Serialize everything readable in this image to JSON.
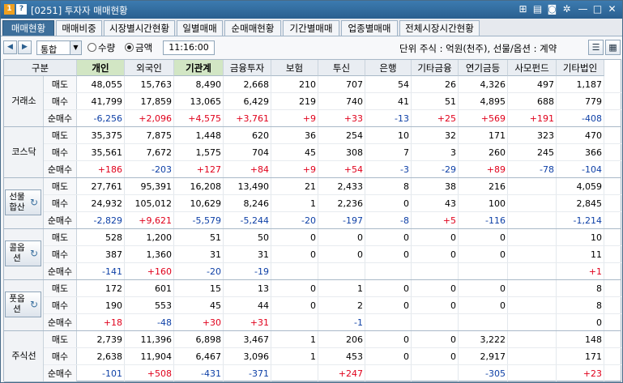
{
  "window": {
    "number": "1",
    "help": "?",
    "title": "[0251] 투자자 매매현황"
  },
  "tabs": [
    "매매현황",
    "매매비중",
    "시장별시간현황",
    "일별매매",
    "순매매현황",
    "기간별매매",
    "업종별매매",
    "전체시장시간현황"
  ],
  "active_tab": 0,
  "toolbar": {
    "market": "통합",
    "radio_qty": "수량",
    "radio_amount": "금액",
    "selected": "금액",
    "time": "11:16:00",
    "unit": "단위 주식 : 억원(천주), 선물/옵션 : 계약"
  },
  "table": {
    "corner": "구분",
    "columns": [
      "개인",
      "외국인",
      "기관계",
      "금융투자",
      "보험",
      "투신",
      "은행",
      "기타금융",
      "연기금등",
      "사모펀드",
      "기타법인"
    ],
    "bold_columns": [
      0,
      2
    ],
    "row_labels": [
      "매도",
      "매수",
      "순매수"
    ],
    "groups": [
      {
        "name": "거래소",
        "button": false,
        "rows": [
          [
            "48,055",
            "15,763",
            "8,490",
            "2,668",
            "210",
            "707",
            "54",
            "26",
            "4,326",
            "497",
            "1,187"
          ],
          [
            "41,799",
            "17,859",
            "13,065",
            "6,429",
            "219",
            "740",
            "41",
            "51",
            "4,895",
            "688",
            "779"
          ],
          [
            "-6,256",
            "+2,096",
            "+4,575",
            "+3,761",
            "+9",
            "+33",
            "-13",
            "+25",
            "+569",
            "+191",
            "-408"
          ]
        ]
      },
      {
        "name": "코스닥",
        "button": false,
        "rows": [
          [
            "35,375",
            "7,875",
            "1,448",
            "620",
            "36",
            "254",
            "10",
            "32",
            "171",
            "323",
            "470"
          ],
          [
            "35,561",
            "7,672",
            "1,575",
            "704",
            "45",
            "308",
            "7",
            "3",
            "260",
            "245",
            "366"
          ],
          [
            "+186",
            "-203",
            "+127",
            "+84",
            "+9",
            "+54",
            "-3",
            "-29",
            "+89",
            "-78",
            "-104"
          ]
        ]
      },
      {
        "name": "선물합산",
        "button": true,
        "rows": [
          [
            "27,761",
            "95,391",
            "16,208",
            "13,490",
            "21",
            "2,433",
            "8",
            "38",
            "216",
            "",
            "4,059"
          ],
          [
            "24,932",
            "105,012",
            "10,629",
            "8,246",
            "1",
            "2,236",
            "0",
            "43",
            "100",
            "",
            "2,845"
          ],
          [
            "-2,829",
            "+9,621",
            "-5,579",
            "-5,244",
            "-20",
            "-197",
            "-8",
            "+5",
            "-116",
            "",
            "-1,214"
          ]
        ]
      },
      {
        "name": "콜옵션",
        "button": true,
        "rows": [
          [
            "528",
            "1,200",
            "51",
            "50",
            "0",
            "0",
            "0",
            "0",
            "0",
            "",
            "10"
          ],
          [
            "387",
            "1,360",
            "31",
            "31",
            "0",
            "0",
            "0",
            "0",
            "0",
            "",
            "11"
          ],
          [
            "-141",
            "+160",
            "-20",
            "-19",
            "",
            "",
            "",
            "",
            "",
            "",
            "+1"
          ]
        ]
      },
      {
        "name": "풋옵션",
        "button": true,
        "rows": [
          [
            "172",
            "601",
            "15",
            "13",
            "0",
            "1",
            "0",
            "0",
            "0",
            "",
            "8"
          ],
          [
            "190",
            "553",
            "45",
            "44",
            "0",
            "2",
            "0",
            "0",
            "0",
            "",
            "8"
          ],
          [
            "+18",
            "-48",
            "+30",
            "+31",
            "",
            "-1",
            "",
            "",
            "",
            "",
            "0"
          ]
        ]
      },
      {
        "name": "주식선",
        "button": false,
        "rows": [
          [
            "2,739",
            "11,396",
            "6,898",
            "3,467",
            "1",
            "206",
            "0",
            "0",
            "3,222",
            "",
            "148"
          ],
          [
            "2,638",
            "11,904",
            "6,467",
            "3,096",
            "1",
            "453",
            "0",
            "0",
            "2,917",
            "",
            "171"
          ],
          [
            "-101",
            "+508",
            "-431",
            "-371",
            "",
            "+247",
            "",
            "",
            "-305",
            "",
            "+23"
          ]
        ]
      }
    ]
  },
  "colors": {
    "positive": "#e0001b",
    "negative": "#0d3fa6",
    "title_bar": "#2a5f8f",
    "bold_header": "#d2e6c4"
  }
}
